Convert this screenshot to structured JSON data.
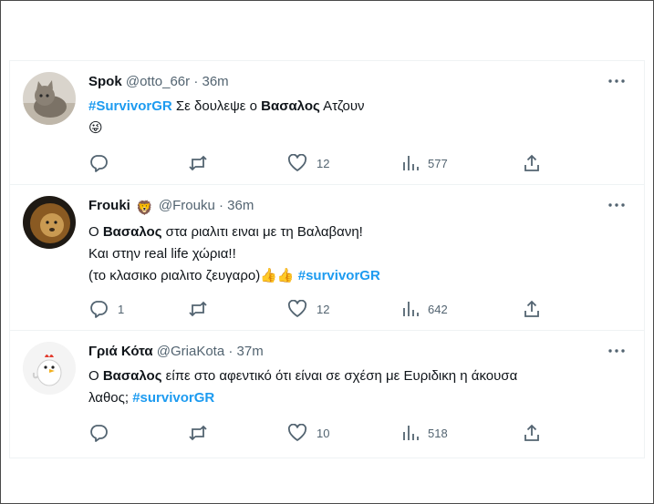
{
  "tweets": [
    {
      "name": "Spok",
      "handle": "@otto_66r",
      "dot": "·",
      "time": "36m",
      "line1": {
        "hashtag": "#SurvivorGR",
        "t1": " Σε δουλεψε ο ",
        "bold": "Βασαλος",
        "t2": " Ατζουν"
      },
      "line2_emoji": "😜",
      "stats": {
        "replies": "",
        "retweets": "",
        "likes": "12",
        "views": "577"
      }
    },
    {
      "name": "Frouki",
      "badge_emoji": "🦁",
      "handle": "@Frouku",
      "dot": "·",
      "time": "36m",
      "line1": {
        "t1": "Ο ",
        "bold": "Βασαλος",
        "t2": " στα ριαλιτι ειναι με τη Βαλαβανη!"
      },
      "line2": "Και στην real life χώρια!!",
      "line3": {
        "t1": "(το κλασικο ριαλιτο ζευγαρο)",
        "emojis": "👍👍",
        "hashtag": "#survivorGR"
      },
      "stats": {
        "replies": "1",
        "retweets": "",
        "likes": "12",
        "views": "642"
      }
    },
    {
      "name": "Γριά Κότα",
      "handle": "@GriaKota",
      "dot": "·",
      "time": "37m",
      "line1": {
        "t1": "Ο ",
        "bold": "Βασαλος",
        "t2": " είπε στο αφεντικό ότι είναι σε σχέση με Ευριδικη η άκουσα"
      },
      "line2": {
        "t1": "λαθος; ",
        "hashtag": "#survivorGR"
      },
      "stats": {
        "replies": "",
        "retweets": "",
        "likes": "10",
        "views": "518"
      }
    }
  ],
  "icons": {
    "reply": "reply-icon",
    "retweet": "retweet-icon",
    "like": "heart-icon",
    "views": "views-icon",
    "share": "share-icon",
    "more": "more-icon"
  },
  "colors": {
    "hashtag": "#1d9bf0",
    "muted": "#536471",
    "text": "#0f1419"
  }
}
